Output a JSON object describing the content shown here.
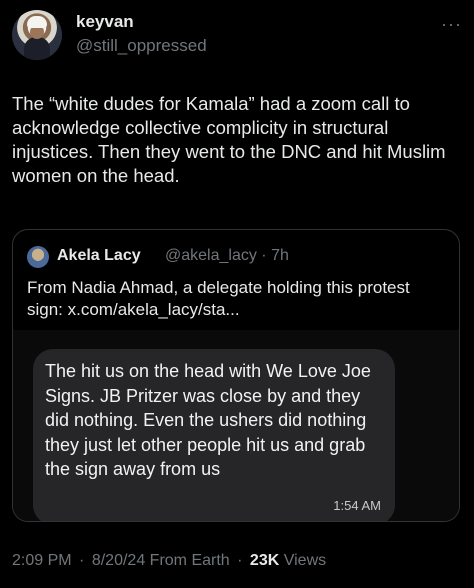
{
  "author": {
    "name": "keyvan",
    "handle": "@still_oppressed",
    "avatar_icon": "avatar"
  },
  "more_icon": "more-icon",
  "tweet": {
    "text": "The “white dudes for Kamala” had a zoom call to acknowledge collective complicity in structural injustices. Then they went to the DNC and hit Muslim women on the head."
  },
  "quote": {
    "name": "Akela Lacy",
    "handle": "@akela_lacy",
    "separator": "·",
    "time": "7h",
    "text": "From Nadia Ahmad, a delegate holding this protest sign: x.com/akela_lacy/sta..."
  },
  "message": {
    "text": "The hit us on the head with We Love Joe Signs. JB Pritzer was close by and they did nothing. Even the ushers did nothing they just let other people hit us and grab the sign away from us",
    "time": "1:54 AM"
  },
  "footer": {
    "time": "2:09 PM",
    "date": "8/20/24",
    "source": "From Earth",
    "views_count": "23K",
    "views_label": "Views",
    "separator": "·"
  }
}
